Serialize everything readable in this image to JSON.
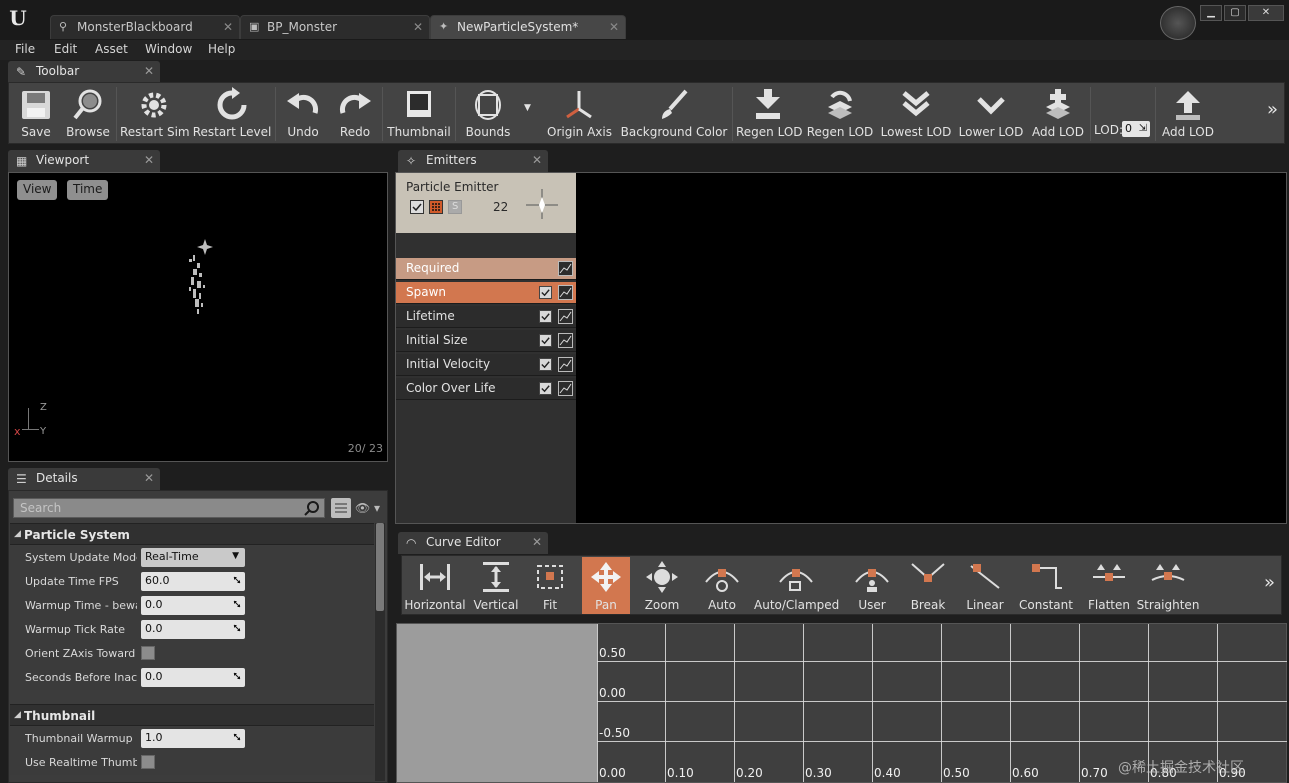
{
  "tabs": [
    {
      "label": "MonsterBlackboard"
    },
    {
      "label": "BP_Monster"
    },
    {
      "label": "NewParticleSystem*"
    }
  ],
  "window_controls": {
    "minimize": "▁",
    "maximize": "▢",
    "close": "✕"
  },
  "menu": [
    "File",
    "Edit",
    "Asset",
    "Window",
    "Help"
  ],
  "toolbar_panel": {
    "title": "Toolbar"
  },
  "toolbar": {
    "save": "Save",
    "browse": "Browse",
    "restart_sim": "Restart Sim",
    "restart_level": "Restart Level",
    "undo": "Undo",
    "redo": "Redo",
    "thumbnail": "Thumbnail",
    "bounds": "Bounds",
    "origin_axis": "Origin Axis",
    "background_color": "Background Color",
    "regen_lod_1": "Regen LOD",
    "regen_lod_2": "Regen LOD",
    "lowest_lod": "Lowest LOD",
    "lower_lod": "Lower LOD",
    "add_lod_1": "Add LOD",
    "lod_label": "LOD:",
    "lod_value": "0",
    "add_lod_2": "Add LOD",
    "more": "»"
  },
  "viewport": {
    "title": "Viewport",
    "view_btn": "View",
    "time_btn": "Time",
    "counter": "20/ 23",
    "axis_z": "Z",
    "axis_y": "Y",
    "axis_x": "x"
  },
  "details": {
    "title": "Details",
    "search_placeholder": "Search",
    "category_particle": "Particle System",
    "category_thumbnail": "Thumbnail",
    "props": [
      {
        "name": "System Update Mode",
        "value": "Real-Time"
      },
      {
        "name": "Update Time FPS",
        "value": "60.0"
      },
      {
        "name": "Warmup Time - bewar",
        "value": "0.0"
      },
      {
        "name": "Warmup Tick Rate",
        "value": "0.0"
      },
      {
        "name": "Orient ZAxis Toward C",
        "value": ""
      },
      {
        "name": "Seconds Before Inacti",
        "value": "0.0"
      }
    ],
    "thumb_props": [
      {
        "name": "Thumbnail Warmup",
        "value": "1.0"
      },
      {
        "name": "Use Realtime Thumbn",
        "value": ""
      }
    ]
  },
  "emitters": {
    "title": "Emitters",
    "emitter_name": "Particle Emitter",
    "emitter_count": "22",
    "modules": [
      "Required",
      "Spawn",
      "Lifetime",
      "Initial Size",
      "Initial Velocity",
      "Color Over Life"
    ]
  },
  "curve_editor": {
    "title": "Curve Editor",
    "buttons": [
      "Horizontal",
      "Vertical",
      "Fit",
      "Pan",
      "Zoom",
      "Auto",
      "Auto/Clamped",
      "User",
      "Break",
      "Linear",
      "Constant",
      "Flatten",
      "Straighten"
    ],
    "more": "»",
    "y_labels": [
      "0.50",
      "0.00",
      "-0.50"
    ],
    "x_labels": [
      "0.00",
      "0.10",
      "0.20",
      "0.30",
      "0.40",
      "0.50",
      "0.60",
      "0.70",
      "0.80",
      "0.90"
    ]
  },
  "watermark": "@稀土掘金技术社区"
}
